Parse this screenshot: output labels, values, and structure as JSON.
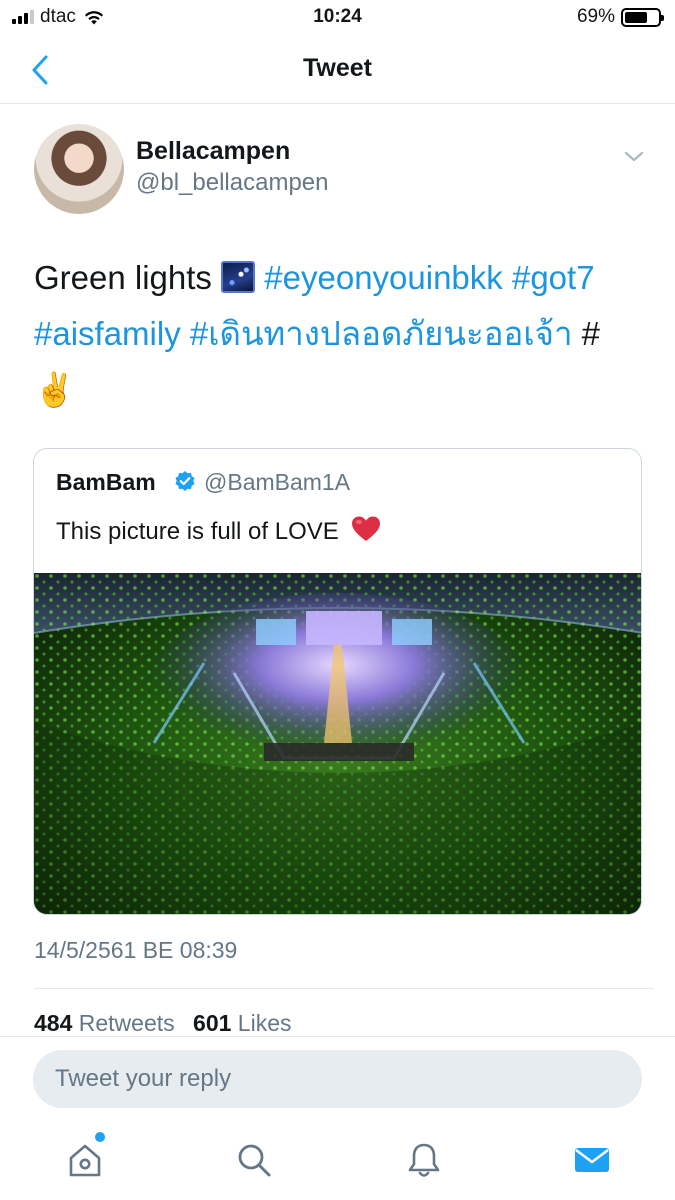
{
  "status_bar": {
    "carrier": "dtac",
    "time": "10:24",
    "battery_text": "69%",
    "battery_level": 0.69
  },
  "nav": {
    "title": "Tweet",
    "back_icon": "chevron-left-icon"
  },
  "author": {
    "name": "Bellacampen",
    "handle": "@bl_bellacampen"
  },
  "tweet": {
    "text_start": "Green lights",
    "hashtags": [
      "#eyeonyouinbkk",
      "#got7",
      "#aisfamily",
      "#เดินทางปลอดภัยนะออเจ้า",
      "#"
    ],
    "emoji_night": "milky-way-emoji",
    "emoji_victory": "✌️"
  },
  "quote": {
    "name": "BamBam",
    "handle": "@BamBam1A",
    "text": "This picture is full of LOVE",
    "heart_emoji": "❤️"
  },
  "meta": {
    "timestamp": "14/5/2561 BE 08:39",
    "retweets_count": "484",
    "retweets_label": "Retweets",
    "likes_count": "601",
    "likes_label": "Likes"
  },
  "reply": {
    "placeholder": "Tweet your reply"
  },
  "tabs": [
    {
      "name": "home",
      "icon": "home-icon"
    },
    {
      "name": "search",
      "icon": "search-icon"
    },
    {
      "name": "notifications",
      "icon": "bell-icon"
    },
    {
      "name": "messages",
      "icon": "mail-icon"
    }
  ],
  "colors": {
    "accent": "#1da1f2",
    "link": "#1b95e0",
    "secondary_text": "#657786",
    "reply_bg": "#e6ecf0"
  }
}
